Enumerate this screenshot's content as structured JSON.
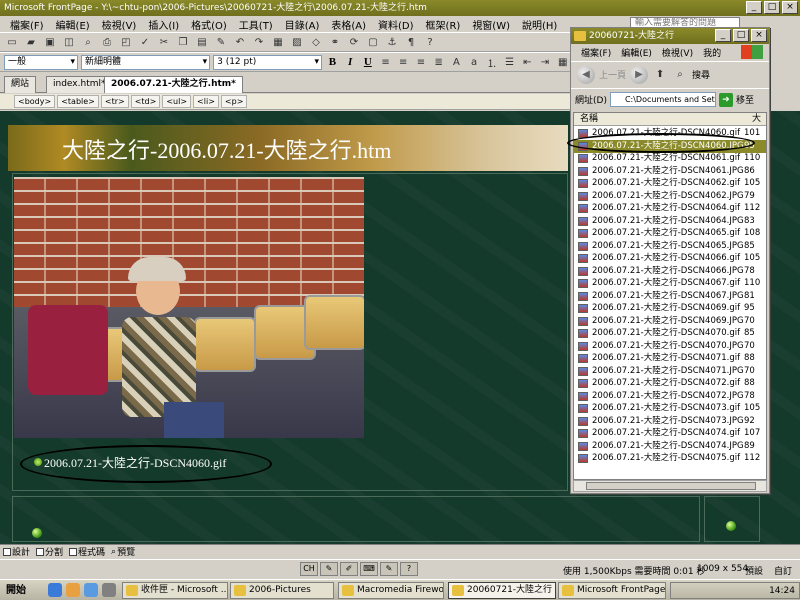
{
  "window": {
    "title": "Microsoft FrontPage - Y:\\~chtu-pon\\2006-Pictures\\20060721-大陸之行\\2006.07.21-大陸之行.htm",
    "controls": [
      "_",
      "□",
      "×"
    ]
  },
  "menu": [
    "檔案(F)",
    "編輯(E)",
    "檢視(V)",
    "插入(I)",
    "格式(O)",
    "工具(T)",
    "目錄(A)",
    "表格(A)",
    "資料(D)",
    "框架(R)",
    "視窗(W)",
    "說明(H)"
  ],
  "help_box": "輸入需要解答的問題",
  "format": {
    "style": "一般",
    "font": "新細明體",
    "size": "3 (12 pt)",
    "bold": "B",
    "italic": "I",
    "underline": "U"
  },
  "tabs": [
    "網站",
    "index.html*",
    "2006.07.21-大陸之行.htm*"
  ],
  "quick_tags": [
    "<body>",
    "<table>",
    "<tr>",
    "<td>",
    "<ul>",
    "<li>",
    "<p>"
  ],
  "page": {
    "banner_title": "大陸之行-2006.07.21-大陸之行.htm",
    "caption": "2006.07.21-大陸之行-DSCN4060.gif"
  },
  "view_tabs": [
    "設計",
    "分割",
    "程式碼",
    "預覽"
  ],
  "status": {
    "speed": "使用 1,500Kbps 需要時間 0:01 秒",
    "resolution": "1009 x 554",
    "mode1": "預設",
    "mode2": "自訂"
  },
  "taskbar": {
    "start": "開始",
    "tasks": [
      "收件匣 - Microsoft ...",
      "2006-Pictures",
      "Macromedia Firewor...",
      "20060721-大陸之行",
      "Microsoft FrontPage ..."
    ],
    "clock": "14:24"
  },
  "explorer": {
    "title": "20060721-大陸之行",
    "menu": [
      "檔案(F)",
      "編輯(E)",
      "檢視(V)",
      "我的"
    ],
    "back": "上一頁",
    "search": "搜尋",
    "address_label": "網址(D)",
    "address_value": "C:\\Documents and Set",
    "go": "移至",
    "col_name": "名稱",
    "col_size": "大",
    "files": [
      {
        "name": "2006.07.21-大陸之行-DSCN4060.gif",
        "size": "101"
      },
      {
        "name": "2006.07.21-大陸之行-DSCN4060.JPG",
        "size": "95"
      },
      {
        "name": "2006.07.21-大陸之行-DSCN4061.gif",
        "size": "110"
      },
      {
        "name": "2006.07.21-大陸之行-DSCN4061.JPG",
        "size": "86"
      },
      {
        "name": "2006.07.21-大陸之行-DSCN4062.gif",
        "size": "105"
      },
      {
        "name": "2006.07.21-大陸之行-DSCN4062.JPG",
        "size": "79"
      },
      {
        "name": "2006.07.21-大陸之行-DSCN4064.gif",
        "size": "112"
      },
      {
        "name": "2006.07.21-大陸之行-DSCN4064.JPG",
        "size": "83"
      },
      {
        "name": "2006.07.21-大陸之行-DSCN4065.gif",
        "size": "108"
      },
      {
        "name": "2006.07.21-大陸之行-DSCN4065.JPG",
        "size": "85"
      },
      {
        "name": "2006.07.21-大陸之行-DSCN4066.gif",
        "size": "105"
      },
      {
        "name": "2006.07.21-大陸之行-DSCN4066.JPG",
        "size": "78"
      },
      {
        "name": "2006.07.21-大陸之行-DSCN4067.gif",
        "size": "110"
      },
      {
        "name": "2006.07.21-大陸之行-DSCN4067.JPG",
        "size": "81"
      },
      {
        "name": "2006.07.21-大陸之行-DSCN4069.gif",
        "size": "95"
      },
      {
        "name": "2006.07.21-大陸之行-DSCN4069.JPG",
        "size": "70"
      },
      {
        "name": "2006.07.21-大陸之行-DSCN4070.gif",
        "size": "85"
      },
      {
        "name": "2006.07.21-大陸之行-DSCN4070.JPG",
        "size": "70"
      },
      {
        "name": "2006.07.21-大陸之行-DSCN4071.gif",
        "size": "88"
      },
      {
        "name": "2006.07.21-大陸之行-DSCN4071.JPG",
        "size": "70"
      },
      {
        "name": "2006.07.21-大陸之行-DSCN4072.gif",
        "size": "88"
      },
      {
        "name": "2006.07.21-大陸之行-DSCN4072.JPG",
        "size": "78"
      },
      {
        "name": "2006.07.21-大陸之行-DSCN4073.gif",
        "size": "105"
      },
      {
        "name": "2006.07.21-大陸之行-DSCN4073.JPG",
        "size": "92"
      },
      {
        "name": "2006.07.21-大陸之行-DSCN4074.gif",
        "size": "107"
      },
      {
        "name": "2006.07.21-大陸之行-DSCN4074.JPG",
        "size": "89"
      },
      {
        "name": "2006.07.21-大陸之行-DSCN4075.gif",
        "size": "112"
      }
    ]
  }
}
